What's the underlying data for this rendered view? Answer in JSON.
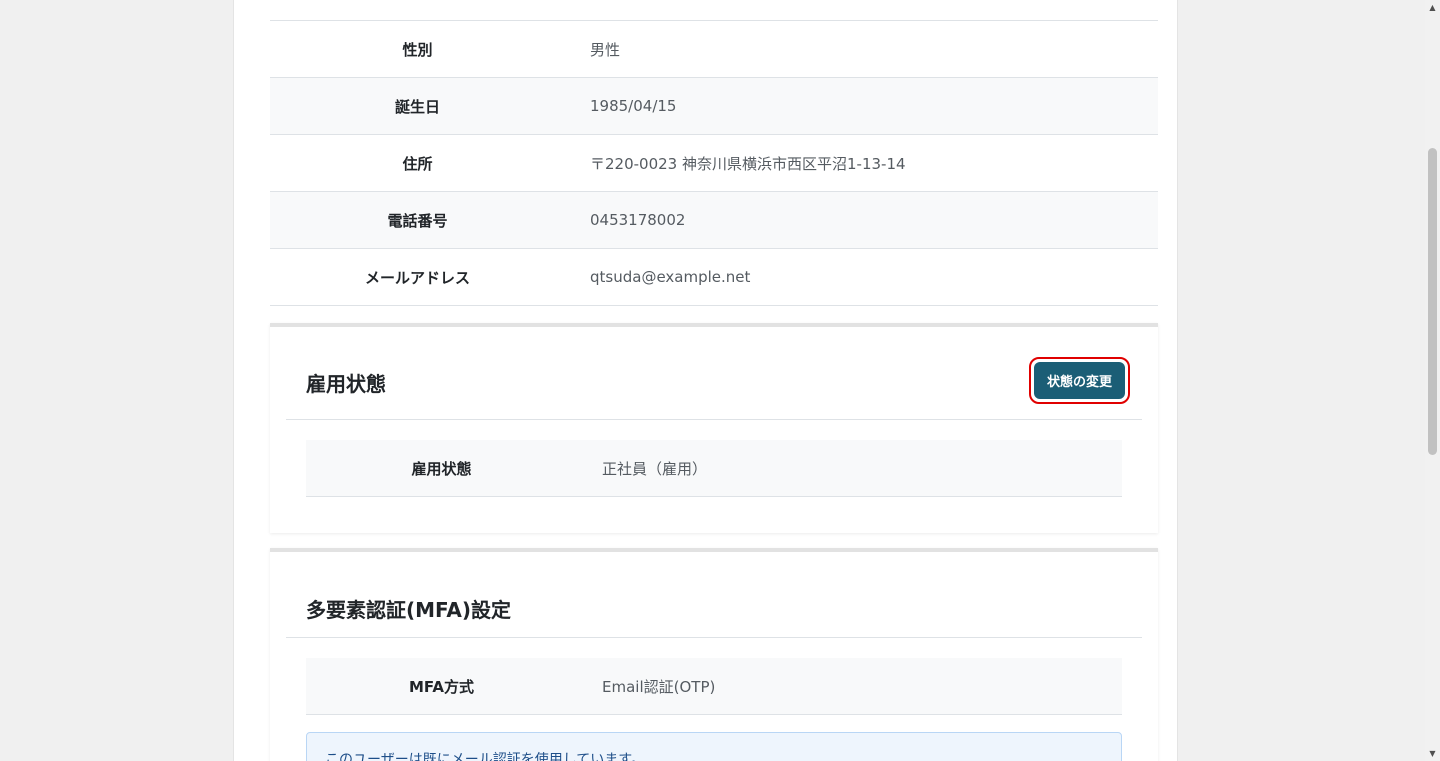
{
  "profile": {
    "rows": [
      {
        "label": "",
        "value": ""
      },
      {
        "label": "性別",
        "value": "男性"
      },
      {
        "label": "誕生日",
        "value": "1985/04/15"
      },
      {
        "label": "住所",
        "value": "〒220-0023 神奈川県横浜市西区平沼1-13-14"
      },
      {
        "label": "電話番号",
        "value": "0453178002"
      },
      {
        "label": "メールアドレス",
        "value": "qtsuda@example.net"
      }
    ]
  },
  "employment": {
    "title": "雇用状態",
    "change_button": "状態の変更",
    "row": {
      "label": "雇用状態",
      "value": "正社員（雇用）"
    }
  },
  "mfa": {
    "title": "多要素認証(MFA)設定",
    "row": {
      "label": "MFA方式",
      "value": "Email認証(OTP)"
    },
    "notice": "このユーザーは既にメール認証を使用しています。"
  },
  "colors": {
    "button": "#1b5e76",
    "highlight": "#e00000"
  }
}
